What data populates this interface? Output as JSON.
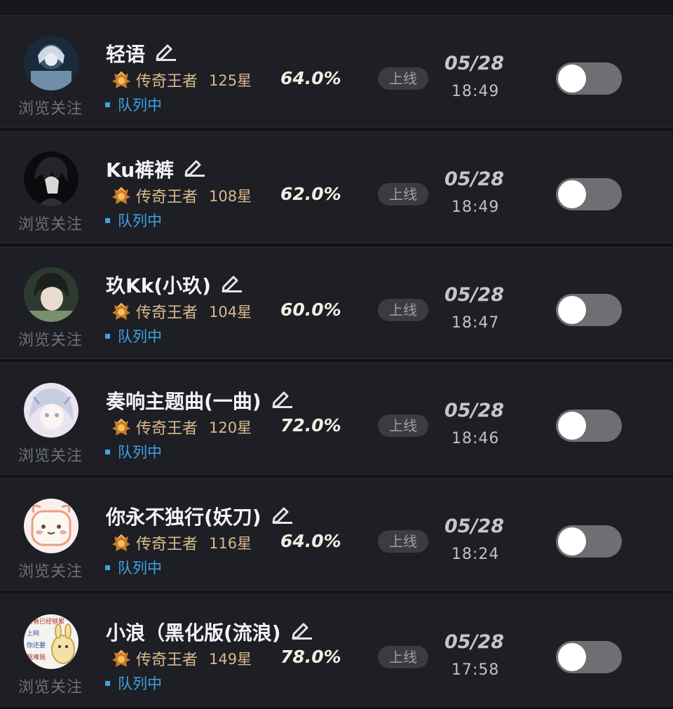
{
  "list": [
    {
      "name": "轻语",
      "rank": "传奇王者",
      "stars": "125星",
      "win_rate": "64.0%",
      "queue_status": "队列中",
      "status_label": "上线",
      "date": "05/28",
      "time": "18:49",
      "follow_label": "浏览关注",
      "toggle_on": false,
      "avatar_colors": [
        "#1a2a3a",
        "#6f8fa8"
      ]
    },
    {
      "name": "Ku裤裤",
      "rank": "传奇王者",
      "stars": "108星",
      "win_rate": "62.0%",
      "queue_status": "队列中",
      "status_label": "上线",
      "date": "05/28",
      "time": "18:49",
      "follow_label": "浏览关注",
      "toggle_on": false,
      "avatar_colors": [
        "#0b0b0e",
        "#d8d8d8"
      ]
    },
    {
      "name": "玖Kk(小玖)",
      "rank": "传奇王者",
      "stars": "104星",
      "win_rate": "60.0%",
      "queue_status": "队列中",
      "status_label": "上线",
      "date": "05/28",
      "time": "18:47",
      "follow_label": "浏览关注",
      "toggle_on": false,
      "avatar_colors": [
        "#2d3a2f",
        "#7a8f6e"
      ]
    },
    {
      "name": "奏响主题曲(一曲)",
      "rank": "传奇王者",
      "stars": "120星",
      "win_rate": "72.0%",
      "queue_status": "队列中",
      "status_label": "上线",
      "date": "05/28",
      "time": "18:46",
      "follow_label": "浏览关注",
      "toggle_on": false,
      "avatar_colors": [
        "#e9e4ef",
        "#9aa6c8"
      ]
    },
    {
      "name": "你永不独行(妖刀)",
      "rank": "传奇王者",
      "stars": "116星",
      "win_rate": "64.0%",
      "queue_status": "队列中",
      "status_label": "上线",
      "date": "05/28",
      "time": "18:24",
      "follow_label": "浏览关注",
      "toggle_on": false,
      "avatar_colors": [
        "#fbeef0",
        "#f0a9b4"
      ]
    },
    {
      "name": "小浪（黑化版(流浪)",
      "rank": "传奇王者",
      "stars": "149星",
      "win_rate": "78.0%",
      "queue_status": "队列中",
      "status_label": "上线",
      "date": "05/28",
      "time": "17:58",
      "follow_label": "浏览关注",
      "toggle_on": false,
      "avatar_colors": [
        "#f5f3ee",
        "#e6c86a"
      ]
    }
  ],
  "avatar_text_lines": [
    "看看已经够累",
    "上网",
    "你还要",
    "我难我"
  ],
  "icons": {
    "edit": "pencil-edit-icon",
    "rank": "legendary-king-rank-icon"
  },
  "colors": {
    "background": "#121317",
    "row": "#1d1f24",
    "rank_text": "#d9b98d",
    "queue_text": "#3fa2e6",
    "toggle_track": "#6e6f73"
  }
}
